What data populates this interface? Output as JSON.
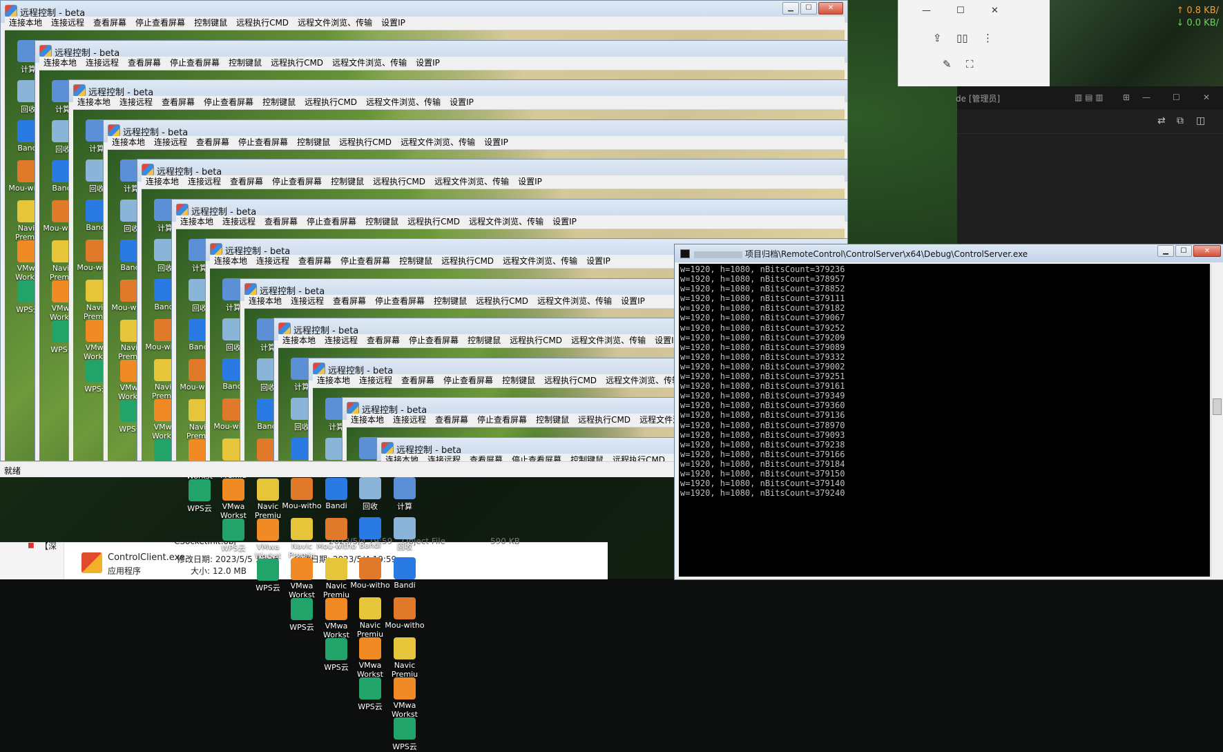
{
  "remote_window": {
    "title": "远程控制 - beta",
    "menu": [
      "连接本地",
      "连接远程",
      "查看屏幕",
      "停止查看屏幕",
      "控制键鼠",
      "远程执行CMD",
      "远程文件浏览、传输",
      "设置IP"
    ],
    "status": "就绪"
  },
  "desktop_icons": [
    "计算",
    "回收",
    "Bandi",
    "Mou-witho",
    "Navic Premiu",
    "VMwa Workst",
    "WPS云"
  ],
  "network": {
    "up": "↑ 0.8 KB/",
    "down": "↓ 0.0 KB/"
  },
  "vscode": {
    "title_suffix": "de [管理员]"
  },
  "explorer": {
    "row1_name": "CSocketInit.obj",
    "row1_date": "2023/5/4 19:59",
    "row1_type": "Object File",
    "row1_size": "590 KB",
    "file_name": "ControlClient.exe",
    "modified": "修改日期: 2023/5/5 12:26",
    "created": "创建日期: 2023/5/4 19:59",
    "file_type": "应用程序",
    "file_size": "大小: 12.0 MB",
    "side_label": "【深"
  },
  "console": {
    "title": "项目归档\\RemoteControl\\ControlServer\\x64\\Debug\\ControlServer.exe",
    "lines": [
      "w=1920, h=1080, nBitsCount=379236",
      "w=1920, h=1080, nBitsCount=378957",
      "w=1920, h=1080, nBitsCount=378852",
      "w=1920, h=1080, nBitsCount=379111",
      "w=1920, h=1080, nBitsCount=379182",
      "w=1920, h=1080, nBitsCount=379067",
      "w=1920, h=1080, nBitsCount=379252",
      "w=1920, h=1080, nBitsCount=379209",
      "w=1920, h=1080, nBitsCount=379089",
      "w=1920, h=1080, nBitsCount=379332",
      "w=1920, h=1080, nBitsCount=379002",
      "w=1920, h=1080, nBitsCount=379251",
      "w=1920, h=1080, nBitsCount=379161",
      "w=1920, h=1080, nBitsCount=379349",
      "w=1920, h=1080, nBitsCount=379360",
      "w=1920, h=1080, nBitsCount=379136",
      "w=1920, h=1080, nBitsCount=378970",
      "w=1920, h=1080, nBitsCount=379093",
      "w=1920, h=1080, nBitsCount=379238",
      "w=1920, h=1080, nBitsCount=379166",
      "w=1920, h=1080, nBitsCount=379184",
      "w=1920, h=1080, nBitsCount=379150",
      "w=1920, h=1080, nBitsCount=379140",
      "w=1920, h=1080, nBitsCount=379240"
    ]
  }
}
